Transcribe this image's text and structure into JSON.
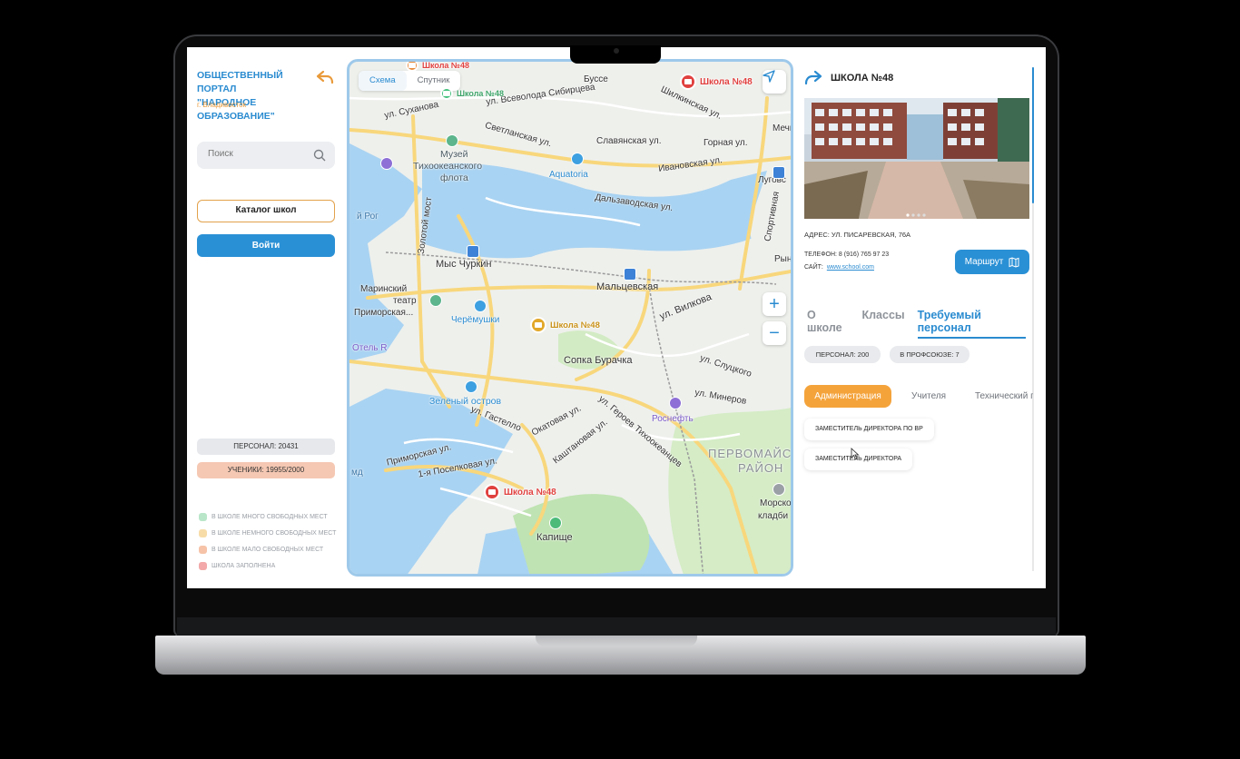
{
  "sidebar": {
    "title_line1": "ОБЩЕСТВЕННЫЙ ПОРТАЛ",
    "title_line2": "\"НАРОДНОЕ ОБРАЗОВАНИЕ\"",
    "city": "г. Владивосток",
    "search_placeholder": "Поиск",
    "catalog_label": "Каталог школ",
    "login_label": "Войти",
    "staff_stat": "ПЕРСОНАЛ: 20431",
    "pupils_stat": "УЧЕНИКИ: 19955/2000",
    "legend": [
      {
        "label": "В ШКОЛЕ МНОГО СВОБОДНЫХ МЕСТ",
        "color": "#b9e6c9"
      },
      {
        "label": "В ШКОЛЕ НЕМНОГО СВОБОДНЫХ МЕСТ",
        "color": "#f7dca8"
      },
      {
        "label": "В ШКОЛЕ МАЛО СВОБОДНЫХ МЕСТ",
        "color": "#f6c3a8"
      },
      {
        "label": "ШКОЛА ЗАПОЛНЕНА",
        "color": "#f3a9a9"
      }
    ]
  },
  "map": {
    "tab_scheme": "Схема",
    "tab_satellite": "Спутник",
    "labels": {
      "l1": "ул. Суханова",
      "l2": "Музей",
      "l3": "Тихоокеанского",
      "l4": "флота",
      "l5": "Светланская ул.",
      "l6": "Славянская ул.",
      "l7": "Aquatoria",
      "l8": "Ивановская ул.",
      "l9": "Горная ул.",
      "l10": "ул. Всеволода Сибирцева",
      "l11": "Шилкинская ул.",
      "l12": "Дальзаводская ул.",
      "l13": "Золотой мост",
      "l14": "й Рог",
      "l15": "Мыс Чуркин",
      "l16": "Мальцевская",
      "l17": "Маринский",
      "l18": "театр",
      "l19": "Приморская...",
      "l20": "Черёмушки",
      "l21": "ул. Вилкова",
      "l22": "Отель R",
      "l23": "Сопка Бурачка",
      "l24": "ул. Слуцкого",
      "l25": "Зеленый остров",
      "l26": "ул. Героев Тихоокеанцев",
      "l27": "ул. Минеров",
      "l28": "Роснефть",
      "l29": "ул. Гастелло",
      "l30": "Окатовая ул.",
      "l31": "Каштановая ул.",
      "l32": "Приморская ул.",
      "l33": "1-я Поселковая ул.",
      "l34": "ПЕРВОМАЙСКИЙ",
      "l35": "РАЙОН",
      "l36": "Морское",
      "l37": "кладби",
      "l38": "Капище",
      "l39": "Буссе",
      "l40": "Луговая",
      "l41": "Спортивная",
      "l42": "Мечникова",
      "l43": "Рын",
      "l44": "Луговс",
      "l45": "мд"
    },
    "pins": {
      "p1": "Школа №48",
      "p2": "Школа №48",
      "p3": "Школа №48",
      "p4": "Школа №48",
      "p5": "Школа №48"
    },
    "zoom_in": "+",
    "zoom_out": "−"
  },
  "school": {
    "title": "ШКОЛА №48",
    "address": "АДРЕС: УЛ. ПИСАРЕВСКАЯ, 76А",
    "phone": "ТЕЛЕФОН: 8 (916) 765 97 23",
    "site_label": "САЙТ:",
    "site_url": "www.school.com",
    "route_label": "Маршрут",
    "tabs": [
      "О школе",
      "Классы",
      "Требуемый персонал"
    ],
    "staff_chip": "ПЕРСОНАЛ: 200",
    "union_chip": "В ПРОФСОЮЗЕ: 7",
    "categories": [
      "Администрация",
      "Учителя",
      "Технический п"
    ],
    "positions": [
      "ЗАМЕСТИТЕЛЬ ДИРЕКТОРА ПО ВР",
      "ЗАМЕСТИТЕЛЬ ДИРЕКТОРА"
    ],
    "photo_dots": 4,
    "accent": "#2a8bd0",
    "orange": "#f4a33b"
  }
}
